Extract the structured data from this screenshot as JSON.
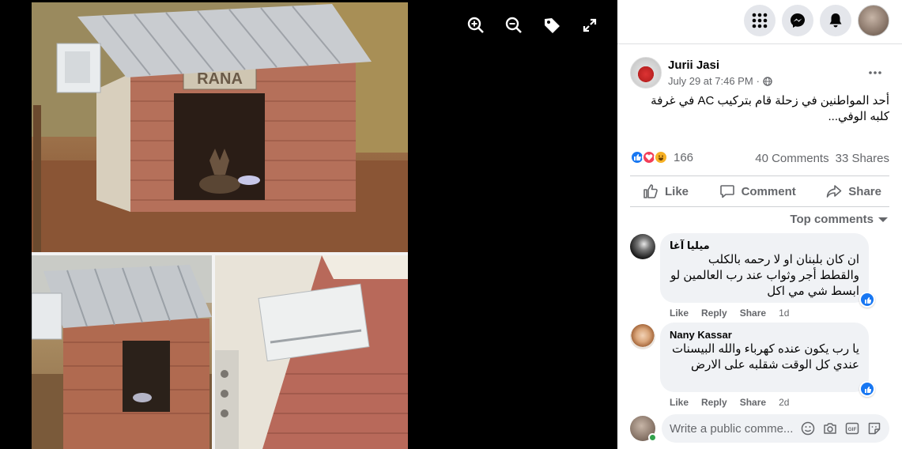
{
  "viewer": {
    "tools": [
      {
        "name": "zoom-in-icon"
      },
      {
        "name": "zoom-out-icon"
      },
      {
        "name": "tag-icon"
      },
      {
        "name": "fullscreen-icon"
      }
    ],
    "doghouse_sign": "RANA"
  },
  "topnav": {
    "menu_icon": "grid-menu-icon",
    "messenger_icon": "messenger-icon",
    "notifications_icon": "bell-icon"
  },
  "post": {
    "author": "Jurii Jasi",
    "time": "July 29 at 7:46 PM",
    "separator": "·",
    "audience_icon": "globe-icon",
    "text": "أحد المواطنين في زحلة قام بتركيب AC في غرفة كلبه الوفي...",
    "reactions": [
      "like",
      "love",
      "haha"
    ],
    "reaction_count": "166",
    "comments_count": "40 Comments",
    "shares_count": "33 Shares",
    "actions": {
      "like": "Like",
      "comment": "Comment",
      "share": "Share"
    },
    "top_comments_label": "Top comments"
  },
  "comments": [
    {
      "author": "ميليا آغا",
      "text": "ان كان بلبنان او لا رحمه بالكلب والقطط أجر وثواب عند رب العالمين لو ابسط شي مي اكل",
      "like": "Like",
      "reply": "Reply",
      "share": "Share",
      "time": "1d"
    },
    {
      "author": "Nany Kassar",
      "text": "يا رب يكون عنده كهرباء والله البيسنات عندي كل الوقت شقلبه على الارض",
      "like": "Like",
      "reply": "Reply",
      "share": "Share",
      "time": "2d"
    }
  ],
  "composer": {
    "placeholder": "Write a public comme..."
  },
  "colors": {
    "accent_blue": "#1877f2",
    "love_red": "#f33e58",
    "haha_yellow": "#f7b125",
    "text_secondary": "#65676b"
  }
}
